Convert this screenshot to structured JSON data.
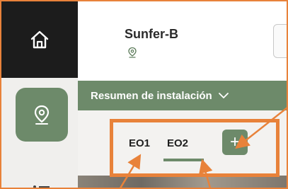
{
  "header": {
    "title": "Sunfer-B"
  },
  "summary_bar": {
    "label": "Resumen de instalación"
  },
  "tabs": [
    {
      "label": "EO1"
    },
    {
      "label": "EO2",
      "active": true
    }
  ],
  "add_button": {
    "label": "+"
  },
  "icons": {
    "home": "home-icon",
    "location": "location-pin-icon",
    "title_pin": "location-pin-icon",
    "chevron": "chevron-down-icon",
    "menu": "list-icon"
  },
  "colors": {
    "accent_green": "#6d8a6a",
    "sidebar_dark": "#1c1c1c",
    "annotation_orange": "#e8823a"
  }
}
